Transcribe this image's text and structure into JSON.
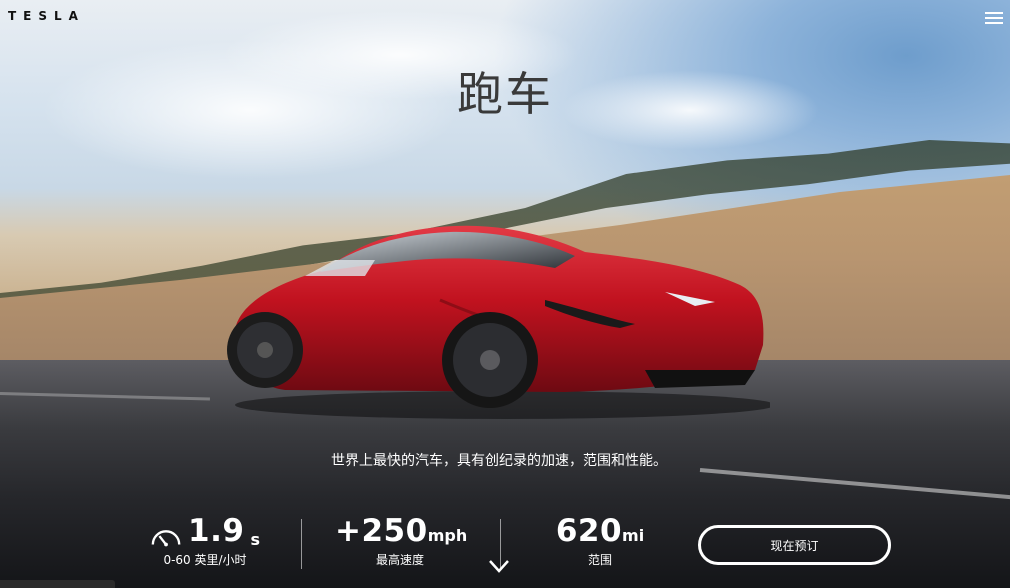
{
  "header": {
    "logo_text": "TESLA",
    "menu_icon": "hamburger-menu-icon"
  },
  "hero": {
    "title": "跑车",
    "tagline": "世界上最快的汽车，具有创纪录的加速，范围和性能。"
  },
  "stats": [
    {
      "value": "1.9",
      "unit": "s",
      "label": "0-60 英里/小时",
      "icon": "speedometer-icon"
    },
    {
      "value": "+250",
      "unit": "mph",
      "label": "最高速度"
    },
    {
      "value": "620",
      "unit": "mi",
      "label": "范围"
    }
  ],
  "cta": {
    "label": "现在预订"
  },
  "scroll": {
    "icon": "chevron-down-icon"
  },
  "colors": {
    "car_red": "#c1121f",
    "text_white": "#ffffff",
    "title_gray": "#3a3a3a"
  }
}
